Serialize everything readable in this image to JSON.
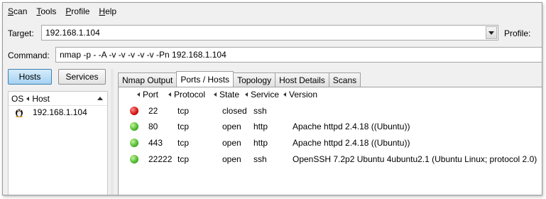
{
  "menu": [
    {
      "label": "Scan",
      "underline": "S",
      "rest": "can"
    },
    {
      "label": "Tools",
      "underline": "T",
      "rest": "ools"
    },
    {
      "label": "Profile",
      "underline": "P",
      "rest": "rofile"
    },
    {
      "label": "Help",
      "underline": "H",
      "rest": "elp"
    }
  ],
  "target": {
    "label": "Target:",
    "value": "192.168.1.104",
    "profile_label": "Profile:"
  },
  "command": {
    "label": "Command:",
    "value": "nmap -p - -A -v -v -v -v -v -Pn 192.168.1.104"
  },
  "left": {
    "hosts_button": "Hosts",
    "services_button": "Services",
    "col_os": "OS",
    "col_host": "Host",
    "hosts": [
      {
        "os_icon": "linux-penguin-icon",
        "address": "192.168.1.104"
      }
    ]
  },
  "tabs": [
    "Nmap Output",
    "Ports / Hosts",
    "Topology",
    "Host Details",
    "Scans"
  ],
  "active_tab": "Ports / Hosts",
  "ports_table": {
    "headers": {
      "port": "Port",
      "protocol": "Protocol",
      "state": "State",
      "service": "Service",
      "version": "Version"
    },
    "rows": [
      {
        "status": "red",
        "port": "22",
        "protocol": "tcp",
        "state": "closed",
        "service": "ssh",
        "version": ""
      },
      {
        "status": "green",
        "port": "80",
        "protocol": "tcp",
        "state": "open",
        "service": "http",
        "version": "Apache httpd 2.4.18 ((Ubuntu))"
      },
      {
        "status": "green",
        "port": "443",
        "protocol": "tcp",
        "state": "open",
        "service": "http",
        "version": "Apache httpd 2.4.18 ((Ubuntu))"
      },
      {
        "status": "green",
        "port": "22222",
        "protocol": "tcp",
        "state": "open",
        "service": "ssh",
        "version": "OpenSSH 7.2p2 Ubuntu 4ubuntu2.1 (Ubuntu Linux; protocol 2.0)"
      }
    ]
  },
  "colors": {
    "open": "#4cb82a",
    "closed": "#d01010",
    "hosts_button": "#a6d2f2"
  }
}
